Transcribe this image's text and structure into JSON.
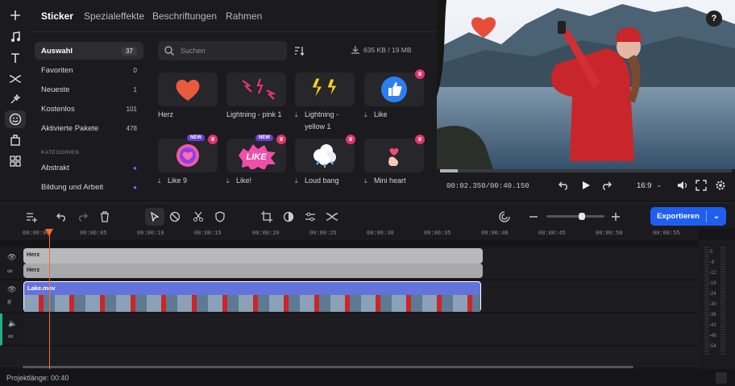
{
  "tabs": [
    "Sticker",
    "Spezialeffekte",
    "Beschriftungen",
    "Rahmen"
  ],
  "sidebar": {
    "items": [
      {
        "label": "Auswahl",
        "count": "37"
      },
      {
        "label": "Favoriten",
        "count": "0"
      },
      {
        "label": "Neueste",
        "count": "1"
      },
      {
        "label": "Kostenlos",
        "count": "101"
      },
      {
        "label": "Aktivierte Pakete",
        "count": "478"
      }
    ],
    "category_heading": "KATEGORIEN",
    "categories": [
      {
        "label": "Abstrakt"
      },
      {
        "label": "Bildung und Arbeit"
      }
    ]
  },
  "search": {
    "placeholder": "Suchen"
  },
  "storage": "635 KB / 19 MB",
  "stickers": [
    {
      "label": "Herz",
      "icon": "heart-icon"
    },
    {
      "label": "Lightning - pink 1",
      "icon": "lightning-pink-icon"
    },
    {
      "label": "Lightning - yellow 1",
      "icon": "lightning-yellow-icon"
    },
    {
      "label": "Like",
      "icon": "thumbs-up-icon"
    },
    {
      "label": "Like 9",
      "icon": "heart-badge-icon"
    },
    {
      "label": "Like!",
      "icon": "like-burst-icon"
    },
    {
      "label": "Loud bang",
      "icon": "bang-cloud-icon"
    },
    {
      "label": "Mini heart",
      "icon": "finger-heart-icon"
    }
  ],
  "badges": {
    "new": "NEW",
    "crown": "♛"
  },
  "preview": {
    "timecode": "00:02.350/00:40.150",
    "aspect": "16:9",
    "help": "?",
    "progress": 0.06
  },
  "export": {
    "label": "Exportieren"
  },
  "ruler": [
    "00:00:00",
    "00:00:05",
    "00:00:10",
    "00:00:15",
    "00:00:20",
    "00:00:25",
    "00:00:30",
    "00:00:35",
    "00:00:40",
    "00:00:45",
    "00:00:50",
    "00:00:55"
  ],
  "tracks": {
    "sticker_clip_1": "Herz",
    "sticker_clip_2": "Herz",
    "video_clip": "Lake.mov"
  },
  "meter_labels": [
    "0",
    "-6",
    "-12",
    "-18",
    "-24",
    "-30",
    "-36",
    "-42",
    "-48",
    "-54"
  ],
  "status": "Projektlänge: 00:40",
  "colors": {
    "accent": "#1f5ff0",
    "playhead": "#ff6a2a",
    "video_clip": "#6373dc",
    "sticker_clip": "#b9b9bc"
  }
}
